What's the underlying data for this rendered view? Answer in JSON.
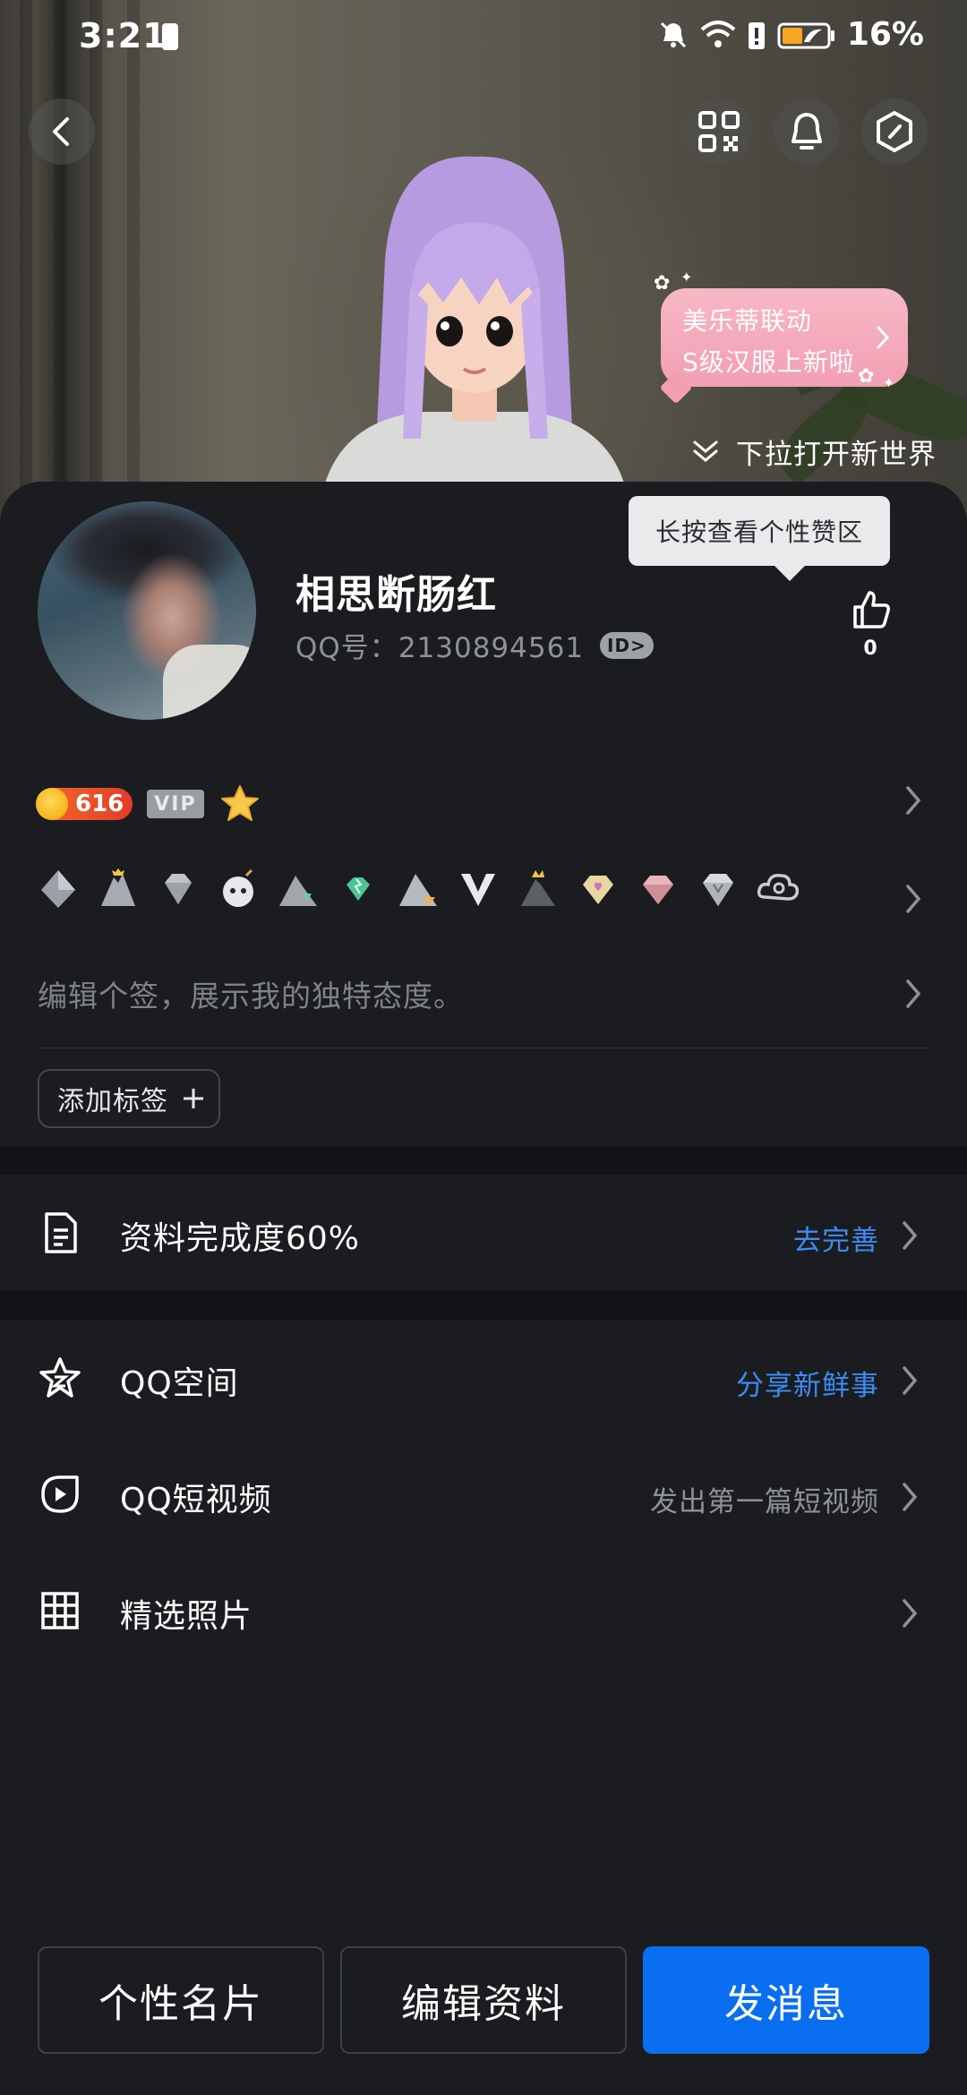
{
  "status_bar": {
    "time": "3:21",
    "battery_pct": "16%"
  },
  "header": {
    "icons": [
      "back-icon",
      "qr-code-icon",
      "bell-icon",
      "hexagon-icon"
    ]
  },
  "promo": {
    "line1": "美乐蒂联动",
    "line2": "S级汉服上新啦"
  },
  "pulldown": {
    "text": "下拉打开新世界"
  },
  "profile": {
    "name": "相思断肠红",
    "qq_label": "QQ号：",
    "qq_number": "2130894561",
    "id_badge": "ID>",
    "tooltip": "长按查看个性赞区",
    "like_count": "0"
  },
  "badges": {
    "level": "616",
    "vip": "VIP"
  },
  "signature": {
    "placeholder": "编辑个签，展示我的独特态度。"
  },
  "tags": {
    "add_label": "添加标签"
  },
  "completion": {
    "label": "资料完成度60%",
    "action": "去完善"
  },
  "menu": [
    {
      "label": "QQ空间",
      "value": "分享新鲜事",
      "value_color": "#3b8cf5",
      "icon": "qzone-star-icon"
    },
    {
      "label": "QQ短视频",
      "value": "发出第一篇短视频",
      "value_color": "#8e9199",
      "icon": "short-video-icon"
    },
    {
      "label": "精选照片",
      "value": "",
      "icon": "photo-grid-icon"
    }
  ],
  "actions": {
    "card": "个性名片",
    "edit": "编辑资料",
    "message": "发消息"
  },
  "colors": {
    "background": "#1b1c20",
    "accent_blue": "#0a6ef0",
    "link_blue": "#3b8cf5",
    "muted": "#8e9199"
  }
}
